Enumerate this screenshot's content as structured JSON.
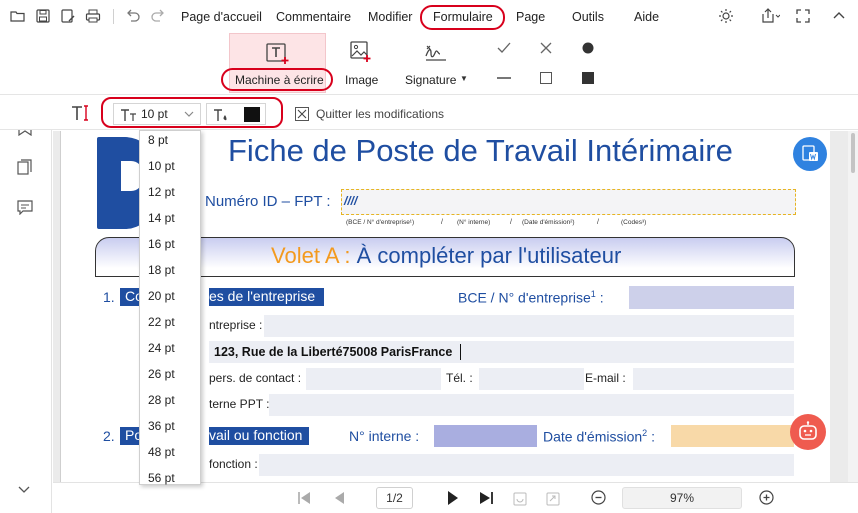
{
  "menubar": {
    "items": [
      "Page d'accueil",
      "Commentaire",
      "Modifier",
      "Formulaire",
      "Page",
      "Outils",
      "Aide"
    ]
  },
  "ribbon": {
    "typewriter_label": "Machine à écrire",
    "image_label": "Image",
    "signature_label": "Signature"
  },
  "subbar": {
    "font_size_value": "10 pt",
    "quit_label": "Quitter les modifications",
    "color_swatch": "#111111"
  },
  "font_sizes": [
    "8 pt",
    "10 pt",
    "12 pt",
    "14 pt",
    "16 pt",
    "18 pt",
    "20 pt",
    "22 pt",
    "24 pt",
    "26 pt",
    "28 pt",
    "36 pt",
    "48 pt",
    "56 pt"
  ],
  "document": {
    "title": "Fiche de Poste de Travail Intérimaire",
    "id_label": "Numéro ID – FPT :",
    "id_value": "////",
    "id_hints": [
      "(BCE / N° d'entreprise¹)",
      "/",
      "(N° interne)",
      "/",
      "(Date d'émission²)",
      "/",
      "(Codes³)"
    ],
    "section_a_prefix": "Volet A :",
    "section_a_text": "À compléter par l'utilisateur",
    "sec1_num": "1.",
    "sec1_left": "Co",
    "sec1_right": "es de l'entreprise",
    "bce_label": "BCE / N° d'entreprise",
    "bce_sup": "1",
    "bce_colon": ":",
    "entreprise_label": "ntreprise :",
    "address_value": "123, Rue de la Liberté75008 ParisFrance",
    "contact_label": "pers. de contact :",
    "tel_label": "Tél. :",
    "email_label": "E-mail :",
    "ppt_label": "terne PPT :",
    "sec2_num": "2.",
    "sec2_left": "Po",
    "sec2_right": "vail ou fonction",
    "interne_label": "N° interne :",
    "date_label": "Date d'émission",
    "date_sup": "2",
    "date_colon": ":",
    "fonction_label": "fonction :"
  },
  "bottombar": {
    "page_indicator": "1/2",
    "zoom": "97%"
  },
  "colors": {
    "accent_red": "#d8001c",
    "doc_blue": "#1f4ea1",
    "volet_orange": "#f39a1e",
    "field_purple": "#cdd0ea",
    "field_orange": "#f8d9a8"
  }
}
